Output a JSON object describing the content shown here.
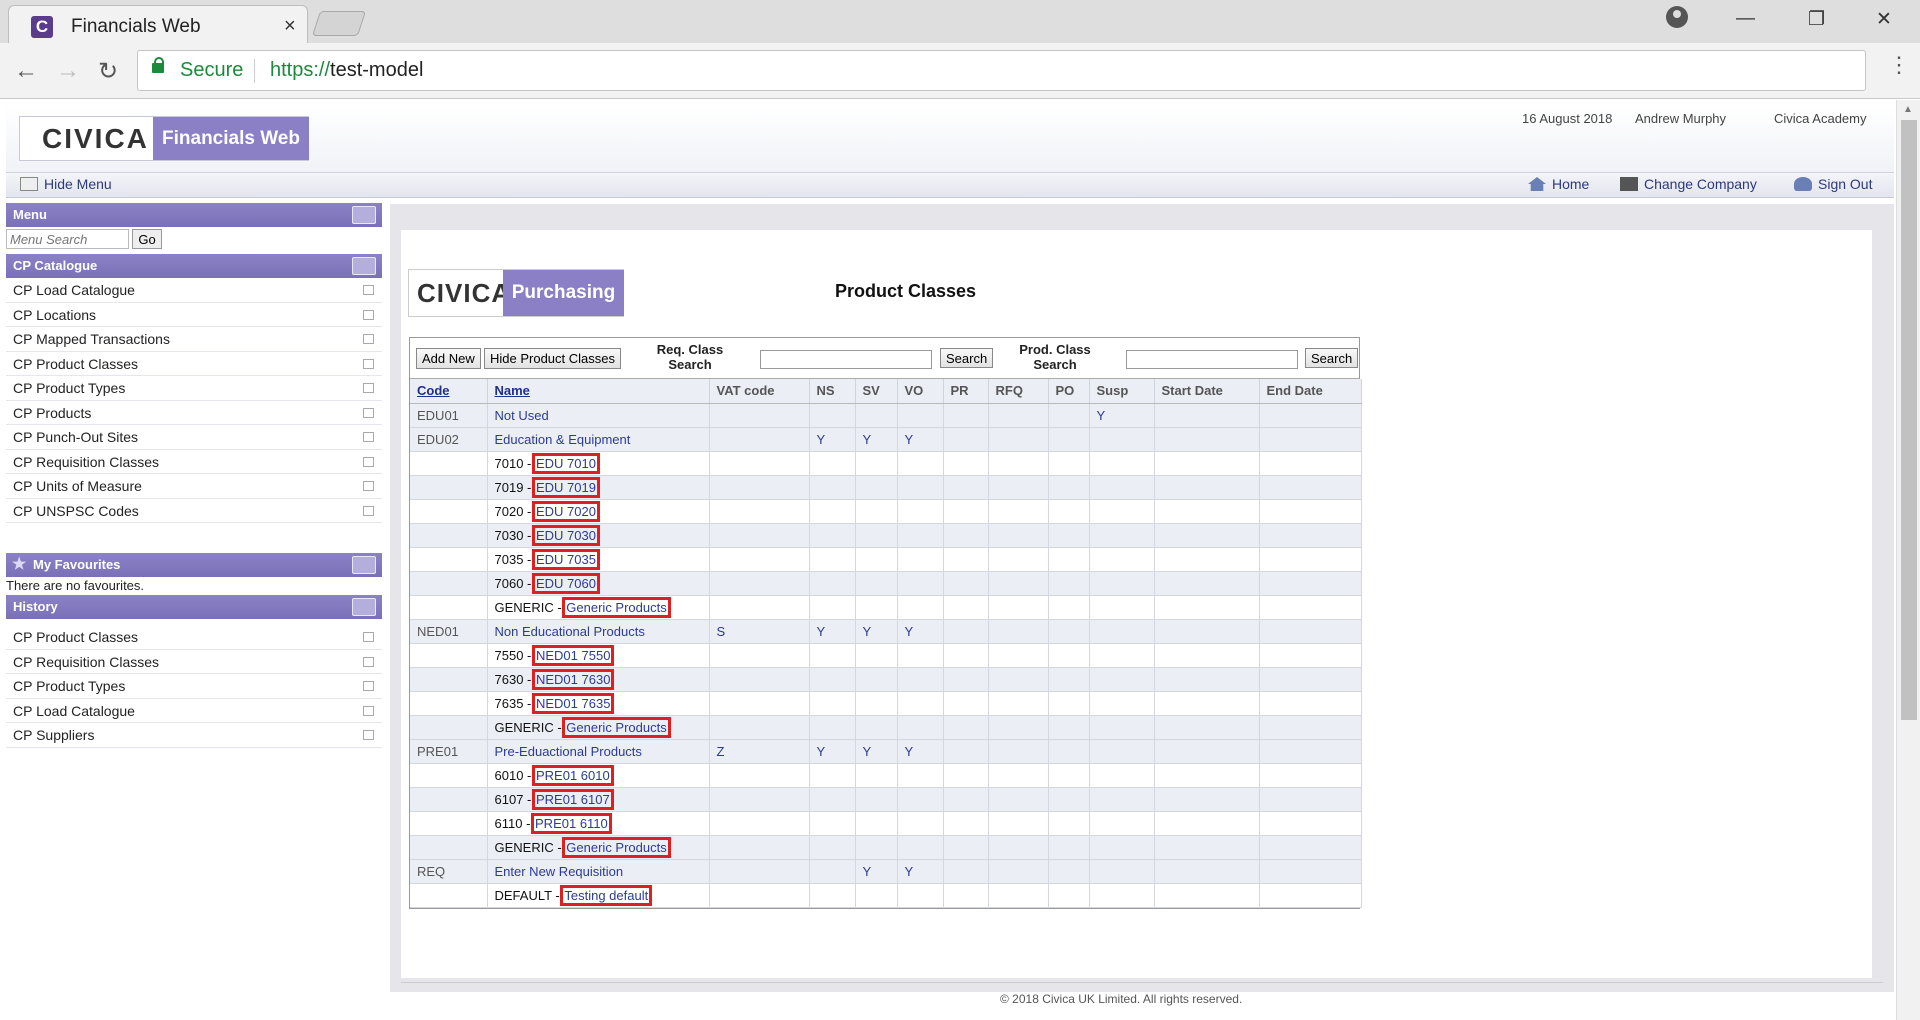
{
  "browser": {
    "tab_title": "Financials Web",
    "tab_close": "×",
    "favicon": "C",
    "secure_label": "Secure",
    "url_scheme": "https://",
    "url_host": "test-model",
    "icons": [
      "back-arrow-icon",
      "forward-arrow-icon",
      "reload-icon",
      "lock-icon",
      "zoom-icon",
      "star-icon",
      "menu-dots-icon",
      "profile-icon",
      "minimize-icon",
      "restore-icon",
      "close-icon"
    ],
    "win_minimize": "—",
    "win_restore": "❐",
    "win_close": "✕",
    "back": "←",
    "forward": "→",
    "reload": "↻",
    "zoom": "⚲",
    "star": "☆",
    "dots": "⋮"
  },
  "header": {
    "logo_brand": "CIVICA",
    "logo_app": "Financials Web",
    "date": "16 August 2018",
    "user": "Andrew Murphy",
    "company": "Civica Academy"
  },
  "toolbar": {
    "hide_menu": "Hide Menu",
    "home": "Home",
    "change_company": "Change Company",
    "sign_out": "Sign Out"
  },
  "menu": {
    "title": "Menu",
    "search_placeholder": "Menu Search",
    "go": "Go",
    "catalogue_title": "CP Catalogue",
    "catalogue_items": [
      "CP Load Catalogue",
      "CP Locations",
      "CP Mapped Transactions",
      "CP Product Classes",
      "CP Product Types",
      "CP Products",
      "CP Punch-Out Sites",
      "CP Requisition Classes",
      "CP Units of Measure",
      "CP UNSPSC Codes"
    ],
    "favourites_title": "My Favourites",
    "no_favourites": "There are no favourites.",
    "history_title": "History",
    "history_items": [
      "CP Product Classes",
      "CP Requisition Classes",
      "CP Product Types",
      "CP Load Catalogue",
      "CP Suppliers"
    ]
  },
  "content": {
    "logo_brand": "CIVICA",
    "logo_app": "Purchasing",
    "title": "Product Classes",
    "add_new": "Add New",
    "hide_classes": "Hide Product Classes",
    "req_search_label_1": "Req. Class",
    "req_search_label_2": "Search",
    "prod_search_label_1": "Prod. Class",
    "prod_search_label_2": "Search",
    "search_btn": "Search",
    "columns": [
      "Code",
      "Name",
      "VAT code",
      "NS",
      "SV",
      "VO",
      "PR",
      "RFQ",
      "PO",
      "Susp",
      "Start Date",
      "End Date"
    ],
    "rows": [
      {
        "type": "parent",
        "code": "EDU01",
        "name": "Not Used",
        "vat": "",
        "ns": "",
        "sv": "",
        "vo": "",
        "susp": "Y"
      },
      {
        "type": "parent",
        "code": "EDU02",
        "name": "Education & Equipment",
        "vat": "",
        "ns": "Y",
        "sv": "Y",
        "vo": "Y",
        "susp": ""
      },
      {
        "type": "child",
        "prefix": "7010 -",
        "link": "EDU 7010"
      },
      {
        "type": "child",
        "prefix": "7019 -",
        "link": "EDU 7019"
      },
      {
        "type": "child",
        "prefix": "7020 -",
        "link": "EDU 7020"
      },
      {
        "type": "child",
        "prefix": "7030 -",
        "link": "EDU 7030"
      },
      {
        "type": "child",
        "prefix": "7035 -",
        "link": "EDU 7035"
      },
      {
        "type": "child",
        "prefix": "7060 -",
        "link": "EDU 7060"
      },
      {
        "type": "child",
        "prefix": "GENERIC -",
        "link": "Generic Products"
      },
      {
        "type": "parent",
        "code": "NED01",
        "name": "Non Educational Products",
        "vat": "S",
        "ns": "Y",
        "sv": "Y",
        "vo": "Y",
        "susp": ""
      },
      {
        "type": "child",
        "prefix": "7550 -",
        "link": "NED01 7550"
      },
      {
        "type": "child",
        "prefix": "7630 -",
        "link": "NED01 7630"
      },
      {
        "type": "child",
        "prefix": "7635 -",
        "link": "NED01 7635"
      },
      {
        "type": "child",
        "prefix": "GENERIC -",
        "link": "Generic Products"
      },
      {
        "type": "parent",
        "code": "PRE01",
        "name": "Pre-Eduactional Products",
        "vat": "Z",
        "ns": "Y",
        "sv": "Y",
        "vo": "Y",
        "susp": ""
      },
      {
        "type": "child",
        "prefix": "6010 -",
        "link": "PRE01 6010"
      },
      {
        "type": "child",
        "prefix": "6107 -",
        "link": "PRE01 6107"
      },
      {
        "type": "child",
        "prefix": "6110 -",
        "link": "PRE01 6110"
      },
      {
        "type": "child",
        "prefix": "GENERIC -",
        "link": "Generic Products"
      },
      {
        "type": "parent",
        "code": "REQ",
        "name": "Enter New Requisition",
        "vat": "",
        "ns": "",
        "sv": "Y",
        "vo": "Y",
        "susp": ""
      },
      {
        "type": "child",
        "prefix": "DEFAULT -",
        "link": "Testing default"
      }
    ]
  },
  "footer": "© 2018 Civica UK Limited. All rights reserved.",
  "colors": {
    "accent": "#8b7fc6",
    "highlight": "#e02020",
    "link": "#2b3a9a",
    "secure": "#1b8a3a"
  }
}
